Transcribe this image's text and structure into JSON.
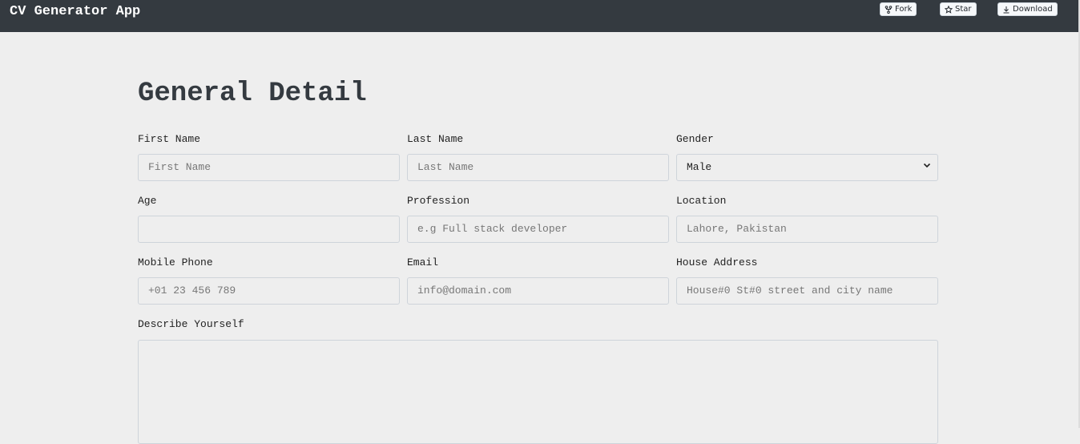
{
  "header": {
    "title": "CV Generator App",
    "buttons": [
      {
        "label": "Fork",
        "icon": "fork-icon"
      },
      {
        "label": "Star",
        "icon": "star-icon"
      },
      {
        "label": "Download",
        "icon": "download-icon"
      }
    ]
  },
  "section_title": "General Detail",
  "fields": [
    {
      "label": "First Name",
      "placeholder": "First Name",
      "value": ""
    },
    {
      "label": "Last Name",
      "placeholder": "Last Name",
      "value": ""
    },
    {
      "label": "Gender",
      "value": "Male",
      "type": "select"
    },
    {
      "label": "Age",
      "placeholder": "",
      "value": ""
    },
    {
      "label": "Profession",
      "placeholder": "e.g Full stack developer",
      "value": ""
    },
    {
      "label": "Location",
      "placeholder": "Lahore, Pakistan",
      "value": ""
    },
    {
      "label": "Mobile Phone",
      "placeholder": "+01 23 456 789",
      "value": ""
    },
    {
      "label": "Email",
      "placeholder": "info@domain.com",
      "value": ""
    },
    {
      "label": "House Address",
      "placeholder": "House#0 St#0 street and city name",
      "value": ""
    }
  ],
  "describe": {
    "label": "Describe Yourself",
    "value": ""
  }
}
